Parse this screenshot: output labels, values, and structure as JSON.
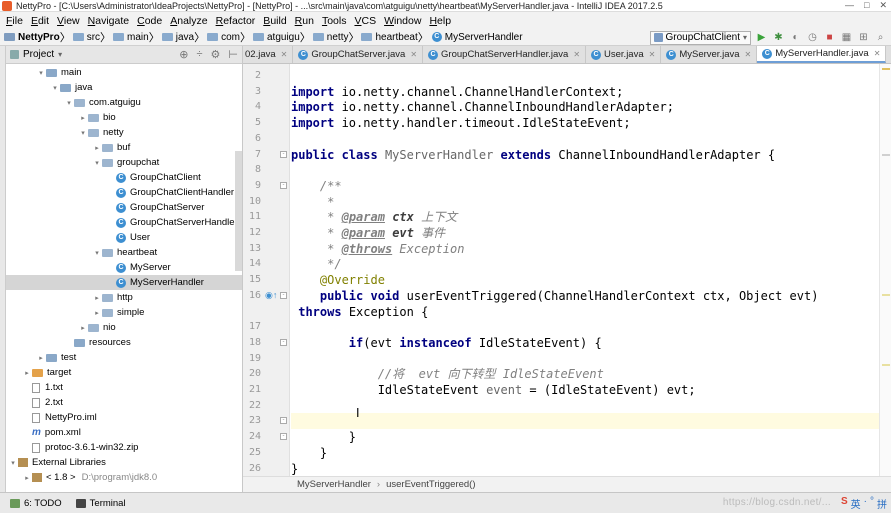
{
  "window": {
    "title": "NettyPro - [C:\\Users\\Administrator\\IdeaProjects\\NettyPro] - [NettyPro] - ...\\src\\main\\java\\com\\atguigu\\netty\\heartbeat\\MyServerHandler.java - IntelliJ IDEA 2017.2.5",
    "controls": [
      "—",
      "□",
      "✕"
    ]
  },
  "menu": [
    "File",
    "Edit",
    "View",
    "Navigate",
    "Code",
    "Analyze",
    "Refactor",
    "Build",
    "Run",
    "Tools",
    "VCS",
    "Window",
    "Help"
  ],
  "nav": {
    "crumbs": [
      "NettyPro",
      "src",
      "main",
      "java",
      "com",
      "atguigu",
      "netty",
      "heartbeat",
      "MyServerHandler"
    ],
    "run_config": "GroupChatClient"
  },
  "project_panel": {
    "title": "Project",
    "tree": [
      {
        "label": "main",
        "indent": 2,
        "arrow": "▾",
        "icon": "folder"
      },
      {
        "label": "java",
        "indent": 3,
        "arrow": "▾",
        "icon": "folder"
      },
      {
        "label": "com.atguigu",
        "indent": 4,
        "arrow": "▾",
        "icon": "pkg"
      },
      {
        "label": "bio",
        "indent": 5,
        "arrow": "▸",
        "icon": "pkg"
      },
      {
        "label": "netty",
        "indent": 5,
        "arrow": "▾",
        "icon": "pkg"
      },
      {
        "label": "buf",
        "indent": 6,
        "arrow": "▸",
        "icon": "pkg"
      },
      {
        "label": "groupchat",
        "indent": 6,
        "arrow": "▾",
        "icon": "pkg"
      },
      {
        "label": "GroupChatClient",
        "indent": 7,
        "arrow": "",
        "icon": "class"
      },
      {
        "label": "GroupChatClientHandler",
        "indent": 7,
        "arrow": "",
        "icon": "class"
      },
      {
        "label": "GroupChatServer",
        "indent": 7,
        "arrow": "",
        "icon": "class"
      },
      {
        "label": "GroupChatServerHandler",
        "indent": 7,
        "arrow": "",
        "icon": "class"
      },
      {
        "label": "User",
        "indent": 7,
        "arrow": "",
        "icon": "class"
      },
      {
        "label": "heartbeat",
        "indent": 6,
        "arrow": "▾",
        "icon": "pkg"
      },
      {
        "label": "MyServer",
        "indent": 7,
        "arrow": "",
        "icon": "class"
      },
      {
        "label": "MyServerHandler",
        "indent": 7,
        "arrow": "",
        "icon": "class",
        "selected": true
      },
      {
        "label": "http",
        "indent": 6,
        "arrow": "▸",
        "icon": "pkg"
      },
      {
        "label": "simple",
        "indent": 6,
        "arrow": "▸",
        "icon": "pkg"
      },
      {
        "label": "nio",
        "indent": 5,
        "arrow": "▸",
        "icon": "pkg"
      },
      {
        "label": "resources",
        "indent": 4,
        "arrow": "",
        "icon": "folder"
      },
      {
        "label": "test",
        "indent": 2,
        "arrow": "▸",
        "icon": "folder"
      },
      {
        "label": "target",
        "indent": 1,
        "arrow": "▸",
        "icon": "orange"
      },
      {
        "label": "1.txt",
        "indent": 1,
        "arrow": "",
        "icon": "file"
      },
      {
        "label": "2.txt",
        "indent": 1,
        "arrow": "",
        "icon": "file"
      },
      {
        "label": "NettyPro.iml",
        "indent": 1,
        "arrow": "",
        "icon": "file"
      },
      {
        "label": "pom.xml",
        "indent": 1,
        "arrow": "",
        "icon": "m"
      },
      {
        "label": "protoc-3.6.1-win32.zip",
        "indent": 1,
        "arrow": "",
        "icon": "file"
      },
      {
        "label": "External Libraries",
        "indent": 0,
        "arrow": "▾",
        "icon": "lib"
      },
      {
        "label": "< 1.8 >",
        "indent": 1,
        "arrow": "▸",
        "icon": "lib",
        "dim": "D:\\program\\jdk8.0"
      }
    ]
  },
  "tabs": [
    {
      "label": "02.java",
      "partial": true
    },
    {
      "label": "GroupChatServer.java"
    },
    {
      "label": "GroupChatServerHandler.java"
    },
    {
      "label": "User.java"
    },
    {
      "label": "MyServer.java"
    },
    {
      "label": "MyServerHandler.java",
      "active": true
    }
  ],
  "code_lines": [
    {
      "n": "2",
      "html": ""
    },
    {
      "n": "3",
      "html": "<span class='kw'>import</span> io.netty.channel.ChannelHandlerContext;"
    },
    {
      "n": "4",
      "html": "<span class='kw'>import</span> io.netty.channel.ChannelInboundHandlerAdapter;"
    },
    {
      "n": "5",
      "html": "<span class='kw'>import</span> io.netty.handler.timeout.IdleStateEvent;"
    },
    {
      "n": "6",
      "html": ""
    },
    {
      "n": "7",
      "html": "<span class='kw'>public class</span> <span class='dimvar'>MyServerHandler</span> <span class='kw'>extends</span> ChannelInboundHandlerAdapter {"
    },
    {
      "n": "8",
      "html": ""
    },
    {
      "n": "9",
      "html": "    <span class='cmt'>/**</span>"
    },
    {
      "n": "10",
      "html": "    <span class='cmt'> *</span>"
    },
    {
      "n": "11",
      "html": "    <span class='cmt'> * </span><span class='doctag'>@param</span><span class='cmt'> </span><span class='docval'>ctx</span><span class='cmt'> 上下文</span>"
    },
    {
      "n": "12",
      "html": "    <span class='cmt'> * </span><span class='doctag'>@param</span><span class='cmt'> </span><span class='docval'>evt</span><span class='cmt'> 事件</span>"
    },
    {
      "n": "13",
      "html": "    <span class='cmt'> * </span><span class='doctag'>@throws</span><span class='cmt'> Exception</span>"
    },
    {
      "n": "14",
      "html": "    <span class='cmt'> */</span>"
    },
    {
      "n": "15",
      "html": "    <span class='ann'>@Override</span>"
    },
    {
      "n": "16",
      "html": "    <span class='kw'>public void</span> userEventTriggered(ChannelHandlerContext ctx, Object evt)"
    },
    {
      "n": "",
      "html": " <span class='kw'>throws</span> Exception {"
    },
    {
      "n": "17",
      "html": ""
    },
    {
      "n": "18",
      "html": "        <span class='kw'>if</span>(evt <span class='kw'>instanceof</span> IdleStateEvent) {"
    },
    {
      "n": "19",
      "html": ""
    },
    {
      "n": "20",
      "html": "            <span class='cmt'>//将  evt 向下转型 IdleStateEvent</span>"
    },
    {
      "n": "21",
      "html": "            IdleStateEvent <span class='dimvar'>event</span> = (IdleStateEvent) evt;"
    },
    {
      "n": "22",
      "html": ""
    },
    {
      "n": "23",
      "html": "",
      "current": true
    },
    {
      "n": "24",
      "html": "        }"
    },
    {
      "n": "25",
      "html": "    }"
    },
    {
      "n": "26",
      "html": "}"
    }
  ],
  "editor_crumbs": [
    "MyServerHandler",
    "userEventTriggered()"
  ],
  "statusbar": {
    "todo": "6: TODO",
    "terminal": "Terminal",
    "watermark": "https://blog.csdn.net/...",
    "ime": [
      "S",
      "英",
      "·",
      "°",
      "拼"
    ]
  },
  "colors": {
    "keyword": "#000080",
    "comment": "#808080",
    "annotation": "#808000",
    "current_line": "#fffbe0",
    "selection": "#d5d5d5",
    "active_tab_underline": "#6e9ed6"
  }
}
